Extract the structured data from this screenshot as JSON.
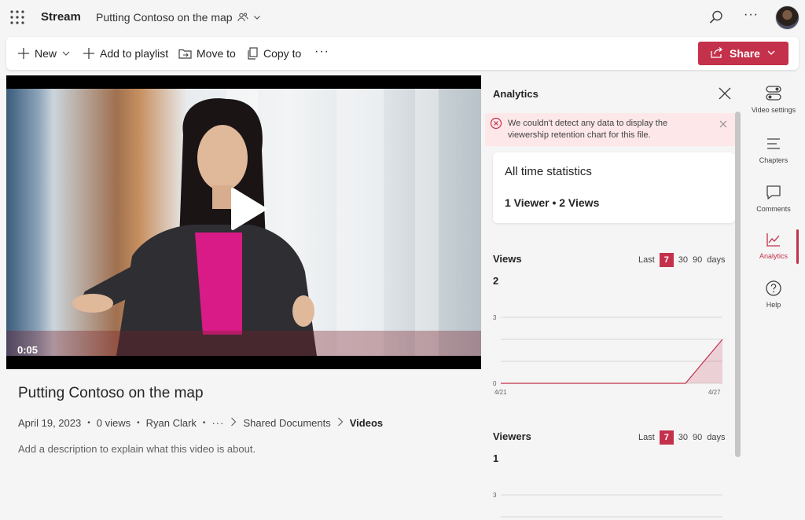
{
  "header": {
    "app_name": "Stream",
    "file_title": "Putting Contoso on the map"
  },
  "toolbar": {
    "new_label": "New",
    "add_to_playlist_label": "Add to playlist",
    "move_to_label": "Move to",
    "copy_to_label": "Copy to",
    "share_label": "Share"
  },
  "video": {
    "timecode": "0:05",
    "title": "Putting Contoso on the map",
    "date": "April 19, 2023",
    "views": "0 views",
    "author": "Ryan Clark",
    "breadcrumb_folder": "Shared Documents",
    "breadcrumb_current": "Videos",
    "description_placeholder": "Add a description to explain what this video is about."
  },
  "analytics": {
    "title": "Analytics",
    "alert_text": "We couldn't detect any data to display the viewership retention chart for this file.",
    "stats_title": "All time statistics",
    "stats_value": "1 Viewer • 2 Views",
    "views_section": {
      "title": "Views",
      "range_prefix": "Last",
      "range_options": [
        "7",
        "30",
        "90"
      ],
      "range_selected": "7",
      "range_suffix": "days",
      "total": "2"
    },
    "viewers_section": {
      "title": "Viewers",
      "range_prefix": "Last",
      "range_options": [
        "7",
        "30",
        "90"
      ],
      "range_selected": "7",
      "range_suffix": "days",
      "total": "1"
    }
  },
  "chart_data": [
    {
      "type": "area",
      "x": [
        "4/21",
        "4/22",
        "4/23",
        "4/24",
        "4/25",
        "4/26",
        "4/27"
      ],
      "values": [
        0,
        0,
        0,
        0,
        0,
        0,
        2
      ],
      "xtick_labels": [
        "4/21",
        "4/27"
      ],
      "ytick_labels": [
        "0",
        "3"
      ],
      "ylim": [
        0,
        3
      ],
      "grid": true,
      "color": "#c4314b"
    },
    {
      "type": "area",
      "ytick_labels": [
        "3"
      ],
      "ylim": [
        0,
        3
      ],
      "grid": true,
      "color": "#c4314b"
    }
  ],
  "rail": {
    "items": [
      {
        "label": "Video settings",
        "icon": "toggle-icon"
      },
      {
        "label": "Chapters",
        "icon": "list-icon"
      },
      {
        "label": "Comments",
        "icon": "comment-icon"
      },
      {
        "label": "Analytics",
        "icon": "analytics-icon"
      },
      {
        "label": "Help",
        "icon": "help-icon"
      }
    ]
  },
  "colors": {
    "accent": "#c4314b",
    "alert_bg": "#fde7e9"
  }
}
